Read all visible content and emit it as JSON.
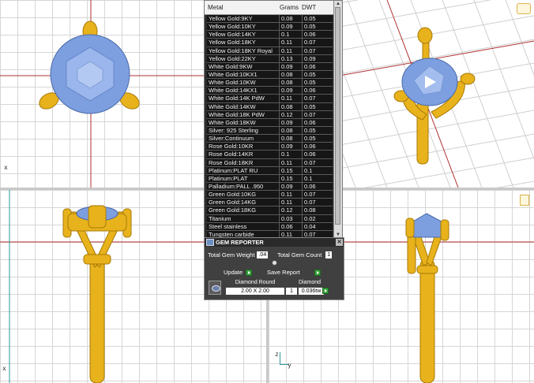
{
  "viewports": {
    "top_left": {
      "axis_label": "x"
    },
    "bottom_left": {
      "axis_label": "x"
    },
    "bottom_right": {
      "axis_z": "z",
      "axis_y": "y"
    }
  },
  "metal_table": {
    "headers": {
      "metal": "Metal",
      "grams": "Grams",
      "dwt": "DWT"
    },
    "rows": [
      {
        "metal": "Yellow Gold:9KY",
        "grams": "0.08",
        "dwt": "0.05"
      },
      {
        "metal": "Yellow Gold:10KY",
        "grams": "0.09",
        "dwt": "0.05"
      },
      {
        "metal": "Yellow Gold:14KY",
        "grams": "0.1",
        "dwt": "0.06"
      },
      {
        "metal": "Yellow Gold:18KY",
        "grams": "0.11",
        "dwt": "0.07"
      },
      {
        "metal": "Yellow Gold:18KY Royal",
        "grams": "0.11",
        "dwt": "0.07"
      },
      {
        "metal": "Yellow Gold:22KY",
        "grams": "0.13",
        "dwt": "0.09"
      },
      {
        "metal": "White Gold:9KW",
        "grams": "0.09",
        "dwt": "0.06"
      },
      {
        "metal": "White Gold:10KX1",
        "grams": "0.08",
        "dwt": "0.05"
      },
      {
        "metal": "White Gold:10KW",
        "grams": "0.08",
        "dwt": "0.05"
      },
      {
        "metal": "White Gold:14KX1",
        "grams": "0.09",
        "dwt": "0.06"
      },
      {
        "metal": "White Gold:14K PdW",
        "grams": "0.11",
        "dwt": "0.07"
      },
      {
        "metal": "White Gold:14KW",
        "grams": "0.08",
        "dwt": "0.05"
      },
      {
        "metal": "White Gold:18K PdW",
        "grams": "0.12",
        "dwt": "0.07"
      },
      {
        "metal": "White Gold:18KW",
        "grams": "0.09",
        "dwt": "0.06"
      },
      {
        "metal": "Silver: 925 Sterling",
        "grams": "0.08",
        "dwt": "0.05"
      },
      {
        "metal": "Silver:Continuum",
        "grams": "0.08",
        "dwt": "0.05"
      },
      {
        "metal": "Rose Gold:10KR",
        "grams": "0.09",
        "dwt": "0.06"
      },
      {
        "metal": "Rose Gold:14KR",
        "grams": "0.1",
        "dwt": "0.06"
      },
      {
        "metal": "Rose Gold:18KR",
        "grams": "0.11",
        "dwt": "0.07"
      },
      {
        "metal": "Platinum:PLAT RU",
        "grams": "0.15",
        "dwt": "0.1"
      },
      {
        "metal": "Platinum:PLAT",
        "grams": "0.15",
        "dwt": "0.1"
      },
      {
        "metal": "Palladium:PALL .950",
        "grams": "0.09",
        "dwt": "0.06"
      },
      {
        "metal": "Green Gold:10KG",
        "grams": "0.11",
        "dwt": "0.07"
      },
      {
        "metal": "Green Gold:14KG",
        "grams": "0.11",
        "dwt": "0.07"
      },
      {
        "metal": "Green Gold:18KG",
        "grams": "0.12",
        "dwt": "0.08"
      },
      {
        "metal": "Titanium",
        "grams": "0.03",
        "dwt": "0.02"
      },
      {
        "metal": "Steel stainless",
        "grams": "0.06",
        "dwt": "0.04"
      },
      {
        "metal": "Tungsten carbide",
        "grams": "0.11",
        "dwt": "0.07"
      }
    ]
  },
  "gem_reporter": {
    "title": "GEM REPORTER",
    "total_weight_label": "Total Gem Weight",
    "total_weight_value": ".04",
    "total_count_label": "Total Gem Count",
    "total_count_value": "1",
    "update_label": "Update",
    "save_report_label": "Save Report",
    "table_headers": {
      "shape": "Diamond Round",
      "type": "Diamond"
    },
    "row": {
      "size": "2.00 X 2.00",
      "count": "1",
      "weight": "0.036tw"
    }
  },
  "colors": {
    "gold": "#e8b21c",
    "stone": "#7d9fe0",
    "axis_red": "#c0392b"
  }
}
